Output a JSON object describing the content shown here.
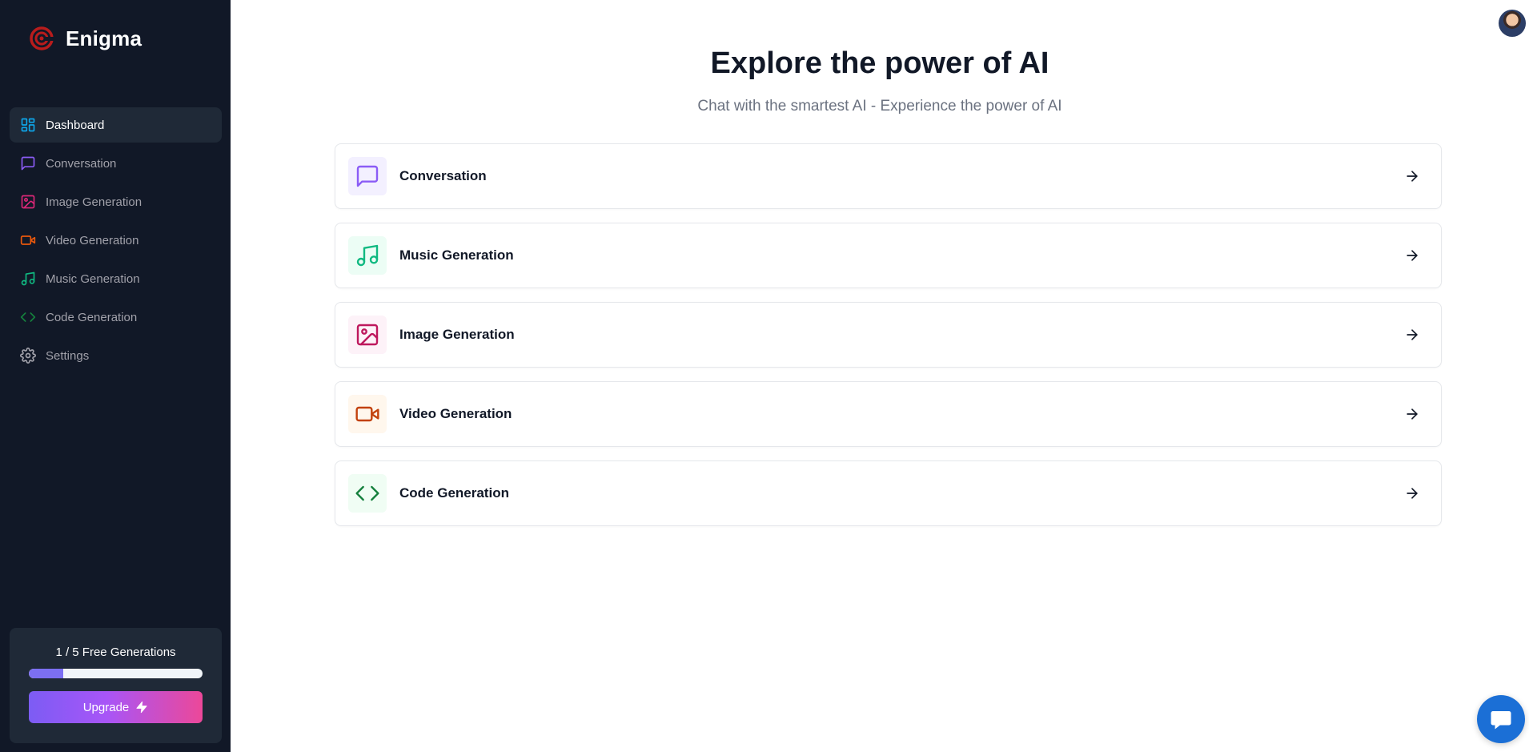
{
  "app": {
    "name": "Enigma"
  },
  "colors": {
    "sidebar_bg": "#111827",
    "dashboard": "#0ea5e9",
    "conversation": "#8b5cf6",
    "image": "#db2777",
    "video": "#ea580c",
    "music": "#10b981",
    "code": "#15803d",
    "settings": "#a1a1aa"
  },
  "sidebar": {
    "items": [
      {
        "label": "Dashboard",
        "icon": "layout-dashboard-icon",
        "active": true
      },
      {
        "label": "Conversation",
        "icon": "message-square-icon"
      },
      {
        "label": "Image Generation",
        "icon": "image-icon"
      },
      {
        "label": "Video Generation",
        "icon": "video-icon"
      },
      {
        "label": "Music Generation",
        "icon": "music-icon"
      },
      {
        "label": "Code Generation",
        "icon": "code-icon"
      },
      {
        "label": "Settings",
        "icon": "settings-icon"
      }
    ],
    "usage": {
      "text": "1 / 5 Free Generations",
      "used": 1,
      "limit": 5,
      "upgrade_label": "Upgrade"
    }
  },
  "hero": {
    "title": "Explore the power of AI",
    "subtitle": "Chat with the smartest AI - Experience the power of AI"
  },
  "tools": [
    {
      "label": "Conversation",
      "icon": "message-square-icon"
    },
    {
      "label": "Music Generation",
      "icon": "music-icon"
    },
    {
      "label": "Image Generation",
      "icon": "image-icon"
    },
    {
      "label": "Video Generation",
      "icon": "video-icon"
    },
    {
      "label": "Code Generation",
      "icon": "code-icon"
    }
  ]
}
